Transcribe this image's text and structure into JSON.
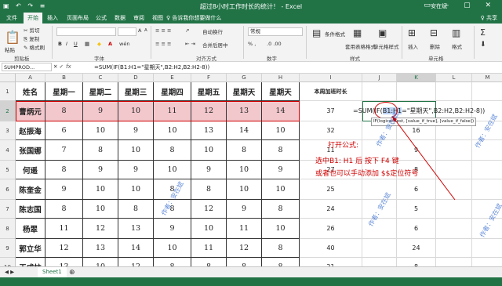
{
  "window": {
    "title": "超过8小时工作时长的统计！ - Excel",
    "user": "安在斌",
    "qat": "▣ ↶ ↷ ≡",
    "controls": "▭ – ▢ ✕"
  },
  "tabs": [
    "文件",
    "开始",
    "插入",
    "页面布局",
    "公式",
    "数据",
    "审阅",
    "视图"
  ],
  "tell_me": "告诉我你想要做什么",
  "share": "♀ 共享",
  "ribbon": {
    "clipboard": {
      "cut": "✂ 剪切",
      "copy": "⎘ 复制",
      "format_painter": "✎ 格式刷",
      "paste": "粘贴",
      "label": "剪贴板"
    },
    "font": {
      "name": "",
      "size": "",
      "bold": "B",
      "italic": "I",
      "underline": "U",
      "grow": "A",
      "shrink": "A",
      "wen": "wén",
      "label": "字体"
    },
    "alignment": {
      "wrap": "自动换行",
      "merge": "合并后居中",
      "label": "对齐方式"
    },
    "number": {
      "format": "常规",
      "pct": "% ,",
      "label": "数字"
    },
    "styles": {
      "conditional": "条件格式",
      "table": "套用表格格式",
      "cell": "单元格样式",
      "label": "样式"
    },
    "cells": {
      "insert": "插入",
      "delete": "删除",
      "format": "格式",
      "label": "单元格"
    }
  },
  "formula_bar": {
    "name_box": "SUMPROD...",
    "fx": "fx",
    "formula": "=SUM(IF(B1:H1=\"星期天\",B2:H2,B2:H2-8))"
  },
  "columns": [
    "A",
    "B",
    "C",
    "D",
    "E",
    "F",
    "G",
    "H",
    "I",
    "J",
    "K",
    "L",
    "M"
  ],
  "rows": [
    "1",
    "2",
    "3",
    "4",
    "5",
    "6",
    "7",
    "8",
    "9",
    "10"
  ],
  "table": {
    "header": [
      "姓名",
      "星期一",
      "星期二",
      "星期三",
      "星期四",
      "星期五",
      "星期天",
      "星期天"
    ],
    "rows": [
      {
        "name": "曹炳元",
        "values": [
          "8",
          "9",
          "10",
          "11",
          "12",
          "13",
          "14"
        ],
        "total": "37"
      },
      {
        "name": "赵振海",
        "values": [
          "6",
          "10",
          "9",
          "10",
          "13",
          "14",
          "10"
        ],
        "total": "32"
      },
      {
        "name": "张国娜",
        "values": [
          "7",
          "8",
          "10",
          "8",
          "10",
          "8",
          "8"
        ],
        "total": "11"
      },
      {
        "name": "何遥",
        "values": [
          "8",
          "9",
          "9",
          "10",
          "9",
          "10",
          "9"
        ],
        "total": "27"
      },
      {
        "name": "陈奎金",
        "values": [
          "9",
          "10",
          "10",
          "8",
          "8",
          "10",
          "10"
        ],
        "total": "25"
      },
      {
        "name": "陈志国",
        "values": [
          "8",
          "10",
          "8",
          "8",
          "12",
          "9",
          "8"
        ],
        "total": "24"
      },
      {
        "name": "杨翠",
        "values": [
          "11",
          "12",
          "13",
          "9",
          "10",
          "11",
          "10"
        ],
        "total": "26"
      },
      {
        "name": "郭立华",
        "values": [
          "12",
          "13",
          "14",
          "10",
          "11",
          "12",
          "8"
        ],
        "total": "40"
      },
      {
        "name": "王成柱",
        "values": [
          "13",
          "10",
          "12",
          "8",
          "8",
          "8",
          "8"
        ],
        "total": "21"
      }
    ]
  },
  "i1_label": "本周加班时长",
  "k_values": [
    "",
    "16",
    "9",
    "8",
    "6",
    "5",
    "6",
    "24",
    "8"
  ],
  "editing_formula": {
    "prefix": "=SUM(IF(",
    "ref": "B1:H1",
    "suffix": "=\"星期天\",B2:H2,B2:H2-8))"
  },
  "tooltip": "IF(logical_test, [value_if_true], [value_if_false])",
  "annotation": {
    "line1": "打开公式:",
    "line2": "选中B1:  H1   后  按下   F4   键",
    "line3": "或者也可以手动添加   $$定位符号"
  },
  "watermark": "作者：安在斌",
  "sheet_tab": "Sheet1",
  "colors": {
    "excel_green": "#217346",
    "highlight_row": "#f2c8cd",
    "annotation_red": "#d00000"
  }
}
